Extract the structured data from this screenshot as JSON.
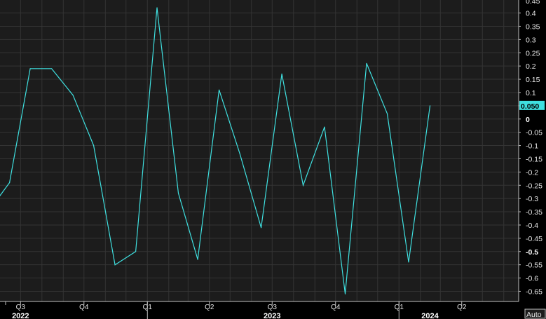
{
  "chart_data": {
    "type": "line",
    "title": "",
    "xlabel": "",
    "ylabel": "",
    "ylim": [
      -0.68,
      0.45
    ],
    "grid": true,
    "x": [
      "2022-04-15",
      "2022-05-15",
      "2022-06-15",
      "2022-07-15",
      "2022-08-15",
      "2022-09-15",
      "2022-10-15",
      "2022-11-15",
      "2022-12-15",
      "2023-01-15",
      "2023-02-15",
      "2023-03-15",
      "2023-04-15",
      "2023-05-15",
      "2023-06-15",
      "2023-07-15",
      "2023-08-15",
      "2023-09-15",
      "2023-10-15",
      "2023-11-15",
      "2023-12-15",
      "2024-01-15",
      "2024-02-15"
    ],
    "series": [
      {
        "values": [
          -0.23,
          -0.35,
          -0.24,
          0.19,
          0.19,
          0.09,
          -0.1,
          -0.55,
          -0.5,
          0.42,
          -0.28,
          -0.53,
          0.11,
          -0.13,
          -0.41,
          0.17,
          -0.25,
          -0.03,
          -0.66,
          0.21,
          0.02,
          -0.54,
          0.05
        ],
        "color": "#3fe0e0"
      }
    ],
    "last_value_label": "0.050",
    "y_ticks": [
      "0.4",
      "0.35",
      "0.3",
      "0.25",
      "0.2",
      "0.15",
      "0.1",
      "0.05",
      "0",
      "-0.05",
      "-0.1",
      "-0.15",
      "-0.2",
      "-0.25",
      "-0.3",
      "-0.35",
      "-0.4",
      "-0.45",
      "-0.5",
      "-0.55",
      "-0.6",
      "-0.65"
    ],
    "x_ticks": [
      {
        "date": "2022-07-01",
        "label": "Q3"
      },
      {
        "date": "2022-10-01",
        "label": "Q4"
      },
      {
        "date": "2023-01-01",
        "label": "Q1"
      },
      {
        "date": "2023-04-01",
        "label": "Q2"
      },
      {
        "date": "2023-07-01",
        "label": "Q3"
      },
      {
        "date": "2023-10-01",
        "label": "Q4"
      },
      {
        "date": "2024-01-01",
        "label": "Q1"
      },
      {
        "date": "2024-04-01",
        "label": "Q2"
      }
    ],
    "years": [
      {
        "center": "2022-07-01",
        "label": "2022"
      },
      {
        "center": "2023-07-01",
        "label": "2023"
      },
      {
        "center": "2024-02-15",
        "label": "2024"
      }
    ],
    "year_boundaries": [
      "2023-01-01",
      "2024-01-01"
    ],
    "top_partial_label": "0.45"
  },
  "scale_mode_label": "Auto",
  "colors": {
    "background": "#000000",
    "plot_background": "#1c1c1c",
    "grid": "#3a3a3a",
    "line": "#3fe0e0",
    "last_label_bg": "#3fe0e0"
  }
}
